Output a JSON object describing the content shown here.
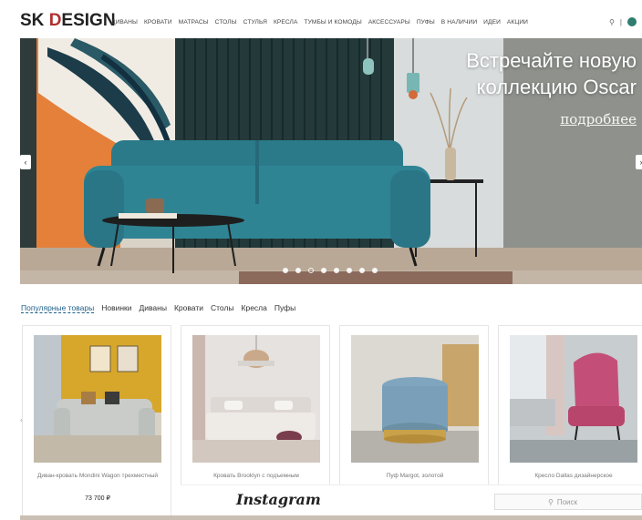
{
  "header": {
    "logo_main": "SK",
    "logo_d": "D",
    "logo_rest": "ESIGN",
    "nav": [
      "ДИВАНЫ",
      "КРОВАТИ",
      "МАТРАСЫ",
      "СТОЛЫ",
      "СТУЛЬЯ",
      "КРЕСЛА",
      "ТУМБЫ И КОМОДЫ",
      "АКСЕССУАРЫ",
      "ПУФЫ",
      "В НАЛИЧИИ",
      "ИДЕИ",
      "АКЦИИ"
    ],
    "icons": [
      "search-icon",
      "user-icon",
      "cart-icon"
    ]
  },
  "hero": {
    "title_line1": "Встречайте новую",
    "title_line2": "коллекцию Oscar",
    "link": "подробнее",
    "slides_total": 8,
    "active_slide": 3
  },
  "tabs": [
    "Популярные товары",
    "Новинки",
    "Диваны",
    "Кровати",
    "Столы",
    "Кресла",
    "Пуфы"
  ],
  "products": [
    {
      "name": "Диван-кровать Mondini Wagon трехместный",
      "price": "73 700 ₽"
    },
    {
      "name": "Кровать Brooklyn с подъемным",
      "price": ""
    },
    {
      "name": "Пуф Margot, золотой",
      "price": ""
    },
    {
      "name": "Кресло Dallas дизайнерское",
      "price": ""
    }
  ],
  "bottom": {
    "instagram": "Instagram",
    "search_placeholder": "Поиск"
  },
  "colors": {
    "accent": "#1f5f8a",
    "sofa": "#2f7f8f",
    "logo_accent": "#b03030"
  }
}
